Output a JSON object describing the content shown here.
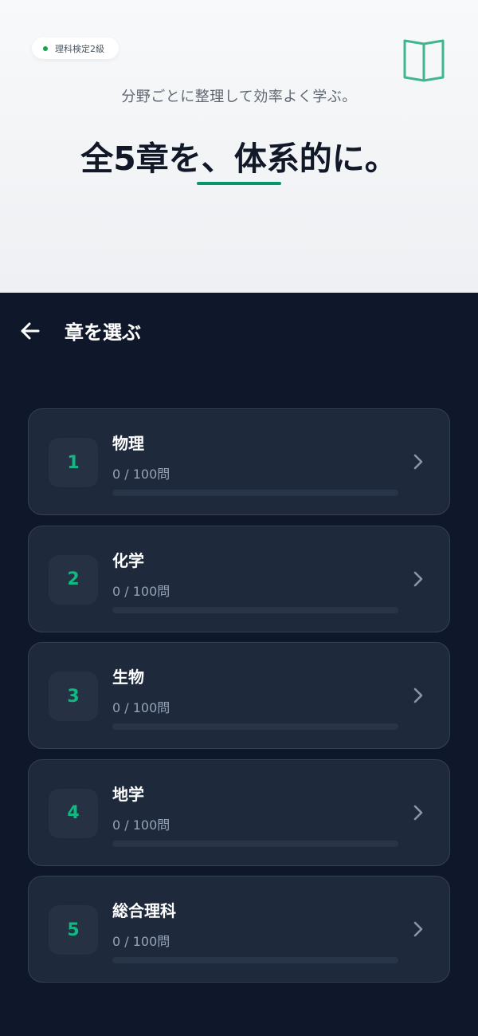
{
  "hero": {
    "badge": "理科検定2級",
    "subtitle": "分野ごとに整理して効率よく学ぶ。",
    "headline": "全5章を、体系的に。",
    "icon": "open-book-icon",
    "accent_color": "#059669"
  },
  "nav": {
    "back_icon": "arrow-left-icon",
    "title": "章を選ぶ"
  },
  "chapters": [
    {
      "number": "1",
      "title": "物理",
      "progress": "0 / 100問",
      "fraction": 0
    },
    {
      "number": "2",
      "title": "化学",
      "progress": "0 / 100問",
      "fraction": 0
    },
    {
      "number": "3",
      "title": "生物",
      "progress": "0 / 100問",
      "fraction": 0
    },
    {
      "number": "4",
      "title": "地学",
      "progress": "0 / 100問",
      "fraction": 0
    },
    {
      "number": "5",
      "title": "総合理科",
      "progress": "0 / 100問",
      "fraction": 0
    }
  ]
}
